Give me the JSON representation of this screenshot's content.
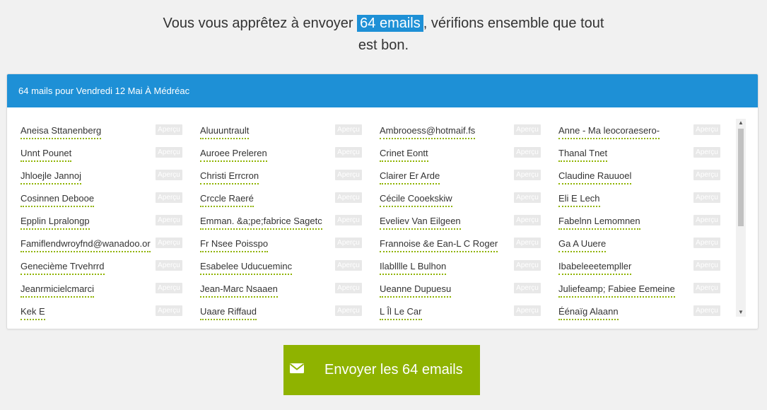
{
  "intro": {
    "before": "Vous vous apprêtez à envoyer ",
    "highlight": "64 emails",
    "after_line1": ", vérifions ensemble que tout",
    "line2": "est bon."
  },
  "panel": {
    "title": "64 mails pour Vendredi 12 Mai À Médréac",
    "preview_label": "Aperçu"
  },
  "recipients": [
    [
      "Aneisa Sttanenberg",
      "Aluuuntrault",
      "Ambrooess@hotmaif.fs",
      "Anne - Ma leocoraesero-"
    ],
    [
      "Unnt Pounet",
      "Auroee Preleren",
      "Crinet Eontt",
      "Thanal Tnet"
    ],
    [
      "Jhloejle Jannoj",
      "Christi Errcron",
      "Clairer Er Arde",
      "Claudine Rauuoel"
    ],
    [
      "Cosinnen Debooe",
      "Crccle Raeré",
      "Cécile Cooekskiw",
      "Eli E Lech"
    ],
    [
      "Epplin Lpralongp",
      "Emman. &a;pe;fabrice Sagetc",
      "Eveliev Van Eilgeen",
      "Fabelnn Lemomnen"
    ],
    [
      "Famiflendwroyfnd@wanadoo.or",
      "Fr Nsee Poisspo",
      "Frannoise &e Ean-L C Roger",
      "Ga A Uuere"
    ],
    [
      "Genecième Trvehrrd",
      "Esabelee Uducueminc",
      "Ilablllle L Bulhon",
      "Ibabeleeetempller"
    ],
    [
      "Jeanrmicielcmarci",
      "Jean-Marc Nsaaen",
      "Ueanne Dupuesu",
      "Juliefeamp; Fabiee Eemeine"
    ],
    [
      "Kek E",
      "Uaare Riffaud",
      "L Îl Le Car",
      "Éénaïg Alaann"
    ]
  ],
  "send_button": {
    "label": "Envoyer les 64 emails",
    "icon": "envelope-icon"
  },
  "colors": {
    "accent": "#1e90d6",
    "button": "#8fb300"
  }
}
